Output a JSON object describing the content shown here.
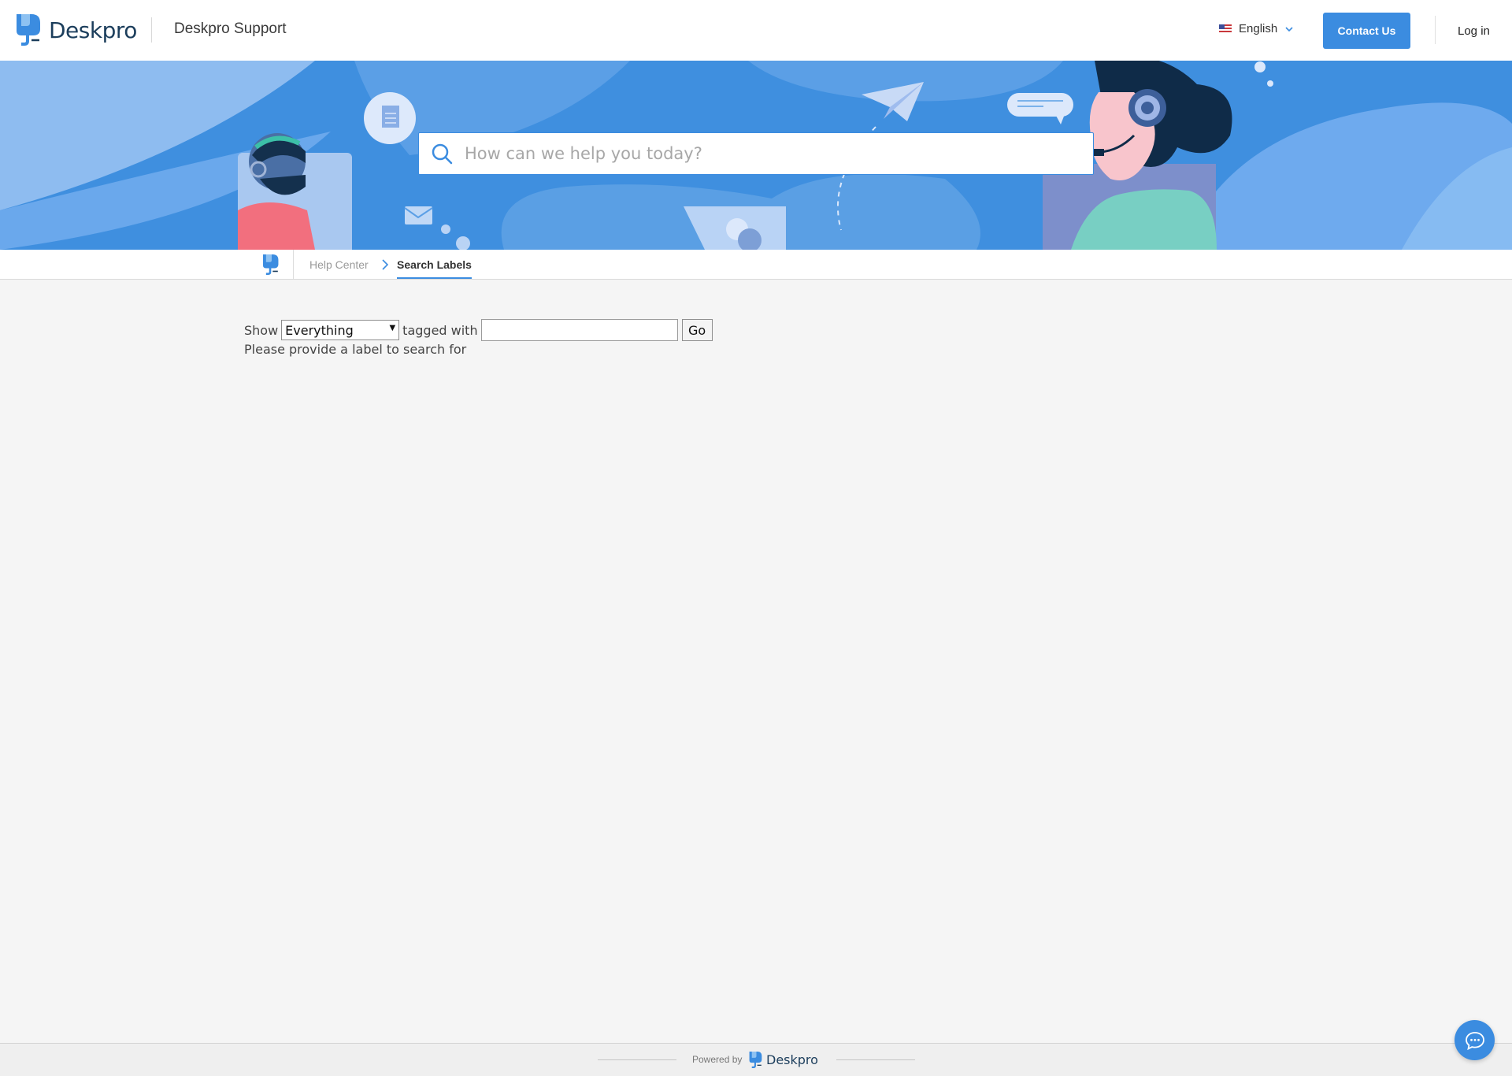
{
  "header": {
    "brand_name": "Deskpro",
    "site_title": "Deskpro Support",
    "language": "English",
    "contact_label": "Contact Us",
    "login_label": "Log in"
  },
  "search": {
    "placeholder": "How can we help you today?"
  },
  "breadcrumb": {
    "items": [
      "Help Center",
      "Search Labels"
    ]
  },
  "form": {
    "show_label": "Show",
    "type_select_value": "Everything",
    "tagged_label": "tagged with",
    "tag_value": "",
    "go_label": "Go",
    "message": "Please provide a label to search for"
  },
  "footer": {
    "powered_by": "Powered by",
    "brand_name": "Deskpro"
  },
  "colors": {
    "accent": "#3b8ce0",
    "hero_bg": "#3f8fdf",
    "brand_text": "#1c3e5c",
    "page_bg": "#f5f5f5"
  },
  "icons": [
    "deskpro-logo-icon",
    "us-flag-icon",
    "chevron-down-icon",
    "search-icon",
    "chevron-right-icon",
    "chat-icon"
  ]
}
